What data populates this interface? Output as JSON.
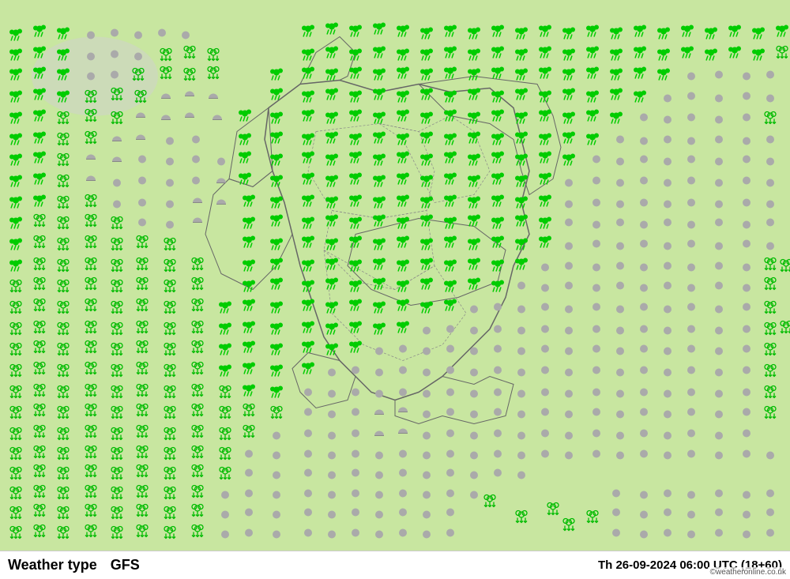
{
  "page": {
    "title": "Weather type GFS",
    "datetime": "Th 26-09-2024 06:00 UTC (18+60)",
    "bottom_left_label": "Weather type",
    "bottom_model": "GFS",
    "watermark": "©weatheronline.co.uk",
    "map_bg_color": "#c8e6a0",
    "border_color": "#555"
  }
}
